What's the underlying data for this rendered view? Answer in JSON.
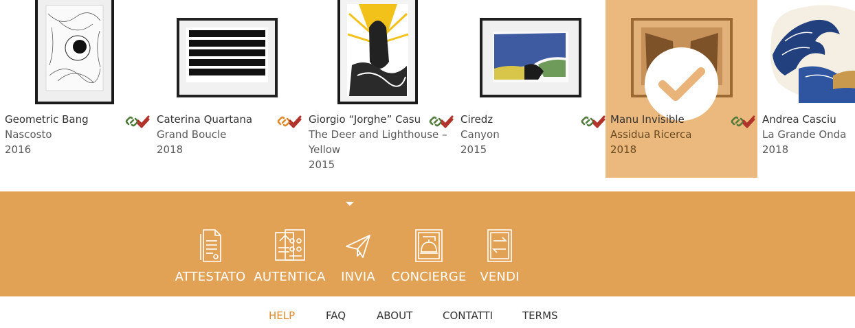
{
  "gallery": {
    "items": [
      {
        "artist": "Geometric Bang",
        "title": "Nascosto",
        "year": "2016",
        "selected": false
      },
      {
        "artist": "Caterina Quartana",
        "title": "Grand Boucle",
        "year": "2018",
        "selected": false,
        "link_color": "#e08a2a"
      },
      {
        "artist": "Giorgio “Jorghe” Casu",
        "title": "The Deer and Lighthouse – Yellow",
        "year": "2015",
        "selected": false
      },
      {
        "artist": "Ciredz",
        "title": "Canyon",
        "year": "2015",
        "selected": false
      },
      {
        "artist": "Manu Invisible",
        "title": "Assidua Ricerca",
        "year": "2018",
        "selected": true
      },
      {
        "artist": "Andrea Casciu",
        "title": "La Grande Onda",
        "year": "2018",
        "selected": false
      }
    ]
  },
  "actions": {
    "attestato": "ATTESTATO",
    "autentica": "AUTENTICA",
    "invia": "INVIA",
    "concierge": "CONCIERGE",
    "vendi": "VENDI"
  },
  "footer": {
    "help": "HELP",
    "faq": "FAQ",
    "about": "ABOUT",
    "contatti": "CONTATTI",
    "terms": "TERMS"
  },
  "colors": {
    "accent": "#e2a256",
    "selected": "#ebb97e",
    "link_icon": "#4f7a3a",
    "check_icon": "#b0322a",
    "active_link": "#e08a2a"
  }
}
